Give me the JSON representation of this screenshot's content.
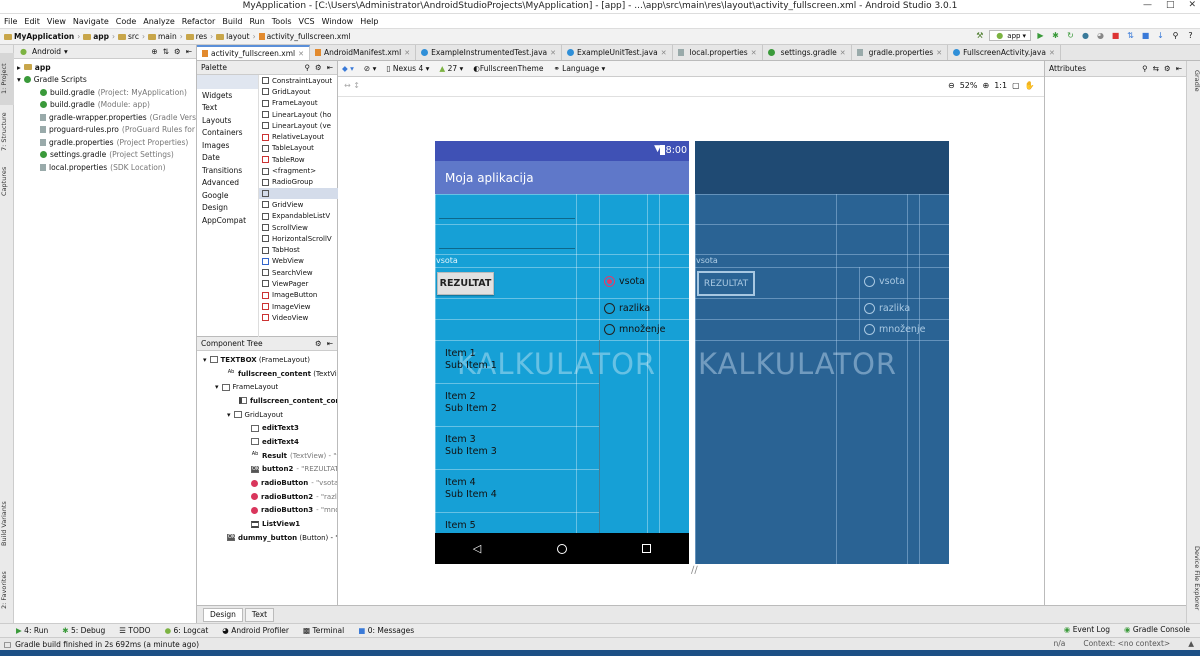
{
  "window": {
    "title": "MyApplication - [C:\\Users\\Administrator\\AndroidStudioProjects\\MyApplication] - [app] - ...\\app\\src\\main\\res\\layout\\activity_fullscreen.xml - Android Studio 3.0.1"
  },
  "menu": [
    "File",
    "Edit",
    "View",
    "Navigate",
    "Code",
    "Analyze",
    "Refactor",
    "Build",
    "Run",
    "Tools",
    "VCS",
    "Window",
    "Help"
  ],
  "breadcrumbs": [
    "MyApplication",
    "app",
    "src",
    "main",
    "res",
    "layout",
    "activity_fullscreen.xml"
  ],
  "run_config": "app",
  "project": {
    "view_mode": "Android",
    "items": [
      {
        "label": "app",
        "hint": ""
      },
      {
        "label": "Gradle Scripts",
        "hint": ""
      },
      {
        "label": "build.gradle",
        "hint": "(Project: MyApplication)"
      },
      {
        "label": "build.gradle",
        "hint": "(Module: app)"
      },
      {
        "label": "gradle-wrapper.properties",
        "hint": "(Gradle Version)"
      },
      {
        "label": "proguard-rules.pro",
        "hint": "(ProGuard Rules for app)"
      },
      {
        "label": "gradle.properties",
        "hint": "(Project Properties)"
      },
      {
        "label": "settings.gradle",
        "hint": "(Project Settings)"
      },
      {
        "label": "local.properties",
        "hint": "(SDK Location)"
      }
    ]
  },
  "left_strip": {
    "project": "1: Project",
    "structure": "7: Structure",
    "captures": "Captures",
    "build_variants": "Build Variants",
    "favorites": "2: Favorites"
  },
  "right_strip": {
    "gradle": "Gradle",
    "device_explorer": "Device File Explorer"
  },
  "editor_tabs": [
    "activity_fullscreen.xml",
    "AndroidManifest.xml",
    "ExampleInstrumentedTest.java",
    "ExampleUnitTest.java",
    "local.properties",
    "settings.gradle",
    "gradle.properties",
    "FullscreenActivity.java"
  ],
  "palette": {
    "title": "Palette",
    "categories": [
      "Widgets",
      "Text",
      "Layouts",
      "Containers",
      "Images",
      "Date",
      "Transitions",
      "Advanced",
      "Google",
      "Design",
      "AppCompat"
    ],
    "items": [
      "ConstraintLayout",
      "GridLayout",
      "FrameLayout",
      "LinearLayout (ho",
      "LinearLayout (ve",
      "RelativeLayout",
      "TableLayout",
      "TableRow",
      "<fragment>",
      "RadioGroup",
      "",
      "GridView",
      "ExpandableListV",
      "ScrollView",
      "HorizontalScrollV",
      "TabHost",
      "WebView",
      "SearchView",
      "ViewPager",
      "ImageButton",
      "ImageView",
      "VideoView"
    ]
  },
  "component_tree": {
    "title": "Component Tree",
    "items": [
      {
        "label": "TEXTBOX",
        "hint": "(FrameLayout)"
      },
      {
        "label": "fullscreen_content",
        "hint": "(TextView"
      },
      {
        "label": "FrameLayout",
        "hint": ""
      },
      {
        "label": "fullscreen_content_contr",
        "hint": ""
      },
      {
        "label": "GridLayout",
        "hint": ""
      },
      {
        "label": "editText3",
        "hint": ""
      },
      {
        "label": "editText4",
        "hint": ""
      },
      {
        "label": "Result",
        "hint": "(TextView) - \"vsota"
      },
      {
        "label": "button2",
        "hint": "- \"REZULTAT"
      },
      {
        "label": "radioButton",
        "hint": "- \"vsota\""
      },
      {
        "label": "radioButton2",
        "hint": "- \"razlika"
      },
      {
        "label": "radioButton3",
        "hint": "- \"mno..."
      },
      {
        "label": "ListView1",
        "hint": ""
      },
      {
        "label": "dummy_button",
        "hint": "(Button) - \"D"
      }
    ]
  },
  "design_toolbar": {
    "device": "Nexus 4",
    "api": "27",
    "theme": "FullscreenTheme",
    "language": "Language",
    "zoom": "52%"
  },
  "attributes": {
    "title": "Attributes"
  },
  "phone": {
    "time": "8:00",
    "app_title": "Moja aplikacija",
    "result_label": "vsota",
    "button": "REZULTAT",
    "radios": [
      "vsota",
      "razlika",
      "množenje"
    ],
    "list": [
      {
        "item": "Item 1",
        "sub": "Sub Item 1"
      },
      {
        "item": "Item 2",
        "sub": "Sub Item 2"
      },
      {
        "item": "Item 3",
        "sub": "Sub Item 3"
      },
      {
        "item": "Item 4",
        "sub": "Sub Item 4"
      },
      {
        "item": "Item 5",
        "sub": ""
      }
    ],
    "big_text": "KALKULATOR"
  },
  "blueprint": {
    "result_label": "vsota",
    "button": "REZULTAT",
    "radios": [
      "vsota",
      "razlika",
      "množenje"
    ],
    "big_text": "KALKULATOR"
  },
  "design_tabs": [
    "Design",
    "Text"
  ],
  "tool_windows": [
    "4: Run",
    "5: Debug",
    "TODO",
    "6: Logcat",
    "Android Profiler",
    "Terminal",
    "0: Messages"
  ],
  "tool_windows_right": [
    "Event Log",
    "Gradle Console"
  ],
  "status": {
    "message": "Gradle build finished in 2s 692ms (a minute ago)",
    "pos": "n/a",
    "context": "Context: <no context>"
  },
  "colors": {
    "accent": "#3f51b5",
    "primary": "#5f78c9",
    "phone_bg": "#16a0d6",
    "radio_checked": "#e23b6a",
    "blueprint": "#2a6394"
  }
}
